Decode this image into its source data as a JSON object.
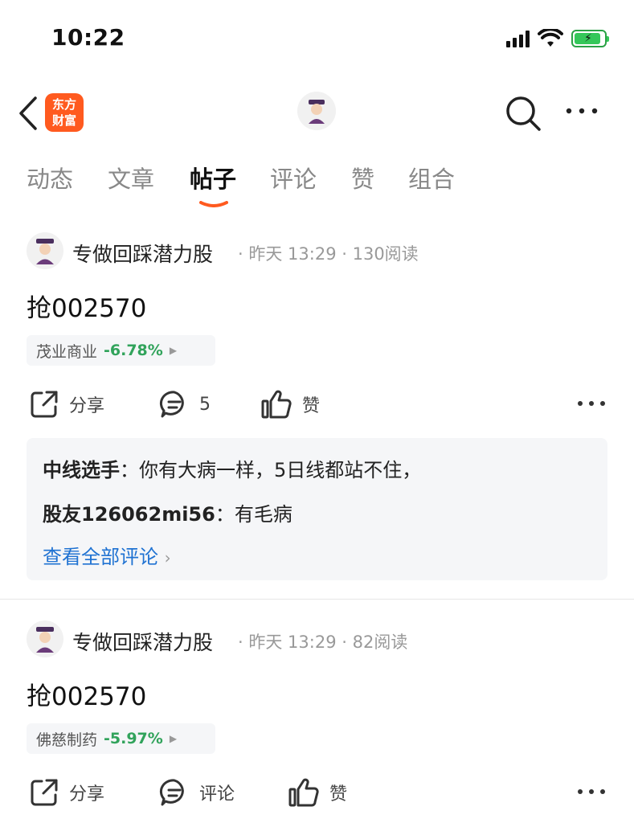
{
  "status": {
    "time": "10:22"
  },
  "header": {
    "brand_line1": "东方",
    "brand_line2": "财富"
  },
  "tabs": [
    {
      "label": "动态"
    },
    {
      "label": "文章"
    },
    {
      "label": "帖子",
      "active": true
    },
    {
      "label": "评论"
    },
    {
      "label": "赞"
    },
    {
      "label": "组合"
    }
  ],
  "posts": [
    {
      "author": "专做回踩潜力股",
      "time": "昨天 13:29",
      "reads": "130阅读",
      "title": "抢002570",
      "stock_name": "茂业商业",
      "stock_change": "-6.78%",
      "share_label": "分享",
      "comment_label": "5",
      "like_label": "赞",
      "comments": [
        {
          "author": "中线选手",
          "text": "你有大病一样，5日线都站不住，"
        },
        {
          "author": "股友126062mi56",
          "text": "有毛病"
        }
      ],
      "view_all": "查看全部评论"
    },
    {
      "author": "专做回踩潜力股",
      "time": "昨天 13:29",
      "reads": "82阅读",
      "title": "抢002570",
      "stock_name": "佛慈制药",
      "stock_change": "-5.97%",
      "share_label": "分享",
      "comment_label": "评论",
      "like_label": "赞"
    }
  ],
  "colors": {
    "accent": "#ff5a1f",
    "down": "#31a35b",
    "link": "#1f72d2"
  }
}
